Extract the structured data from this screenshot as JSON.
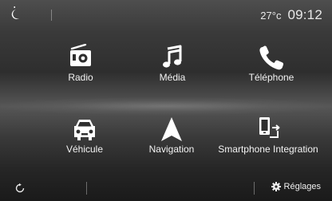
{
  "status": {
    "temperature": "27°c",
    "time": "09:12"
  },
  "menu": [
    {
      "label": "Radio",
      "icon": "radio-icon"
    },
    {
      "label": "Média",
      "icon": "music-note-icon"
    },
    {
      "label": "Téléphone",
      "icon": "phone-icon"
    },
    {
      "label": "Véhicule",
      "icon": "car-icon"
    },
    {
      "label": "Navigation",
      "icon": "navigation-arrow-icon"
    },
    {
      "label": "Smartphone Integration",
      "icon": "smartphone-integration-icon"
    }
  ],
  "bottom": {
    "settings_label": "Réglages"
  },
  "colors": {
    "background": "#2e2e2e",
    "text": "#f2f2f2",
    "icon": "#ffffff"
  }
}
